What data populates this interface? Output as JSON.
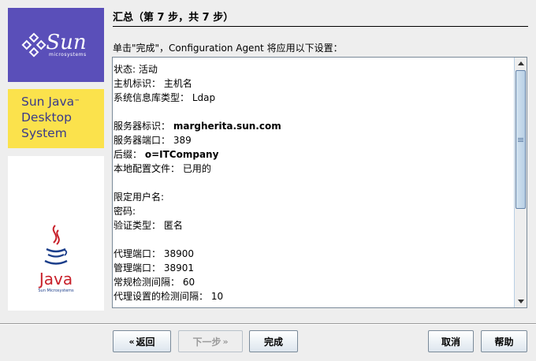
{
  "brand": {
    "sun_name": "Sun",
    "sun_sub": "microsystems",
    "product_line1": "Sun Java",
    "product_tm": "™",
    "product_line2": "Desktop",
    "product_line3": "System",
    "java_name": "Java",
    "java_sub": "Sun Microsystems",
    "panel_color": "#5a4fb9",
    "product_color": "#fbe24c"
  },
  "header": {
    "title": "汇总（第 7 步，共 7 步）",
    "intro": "单击\"完成\"，Configuration Agent 将应用以下设置："
  },
  "settings": [
    {
      "label": "状态:",
      "value": "活动",
      "bold": false
    },
    {
      "label": "主机标识：",
      "value": "主机名",
      "bold": false
    },
    {
      "label": "系统信息库类型：",
      "value": "Ldap",
      "bold": false
    },
    {
      "label": "",
      "value": "",
      "bold": false
    },
    {
      "label": "服务器标识：",
      "value": "margherita.sun.com",
      "bold": true
    },
    {
      "label": "服务器端口：",
      "value": "389",
      "bold": false
    },
    {
      "label": "后缀：",
      "value": "o=ITCompany",
      "bold": true
    },
    {
      "label": "本地配置文件：",
      "value": "已用的",
      "bold": false
    },
    {
      "label": "",
      "value": "",
      "bold": false
    },
    {
      "label": "限定用户名:",
      "value": "",
      "bold": false
    },
    {
      "label": "密码:",
      "value": "",
      "bold": false
    },
    {
      "label": "验证类型：",
      "value": "匿名",
      "bold": false
    },
    {
      "label": "",
      "value": "",
      "bold": false
    },
    {
      "label": "代理端口：",
      "value": "38900",
      "bold": false
    },
    {
      "label": "管理端口：",
      "value": "38901",
      "bold": false
    },
    {
      "label": "常规检测间隔：",
      "value": "60",
      "bold": false
    },
    {
      "label": "代理设置的检测间隔：",
      "value": "10",
      "bold": false
    }
  ],
  "buttons": {
    "back": "返回",
    "next": "下一步",
    "finish": "完成",
    "cancel": "取消",
    "help": "帮助"
  },
  "icons": {
    "back": "chevron-double-left-icon",
    "next": "chevron-double-right-icon",
    "scroll_up": "arrow-up-icon",
    "scroll_down": "arrow-down-icon"
  }
}
